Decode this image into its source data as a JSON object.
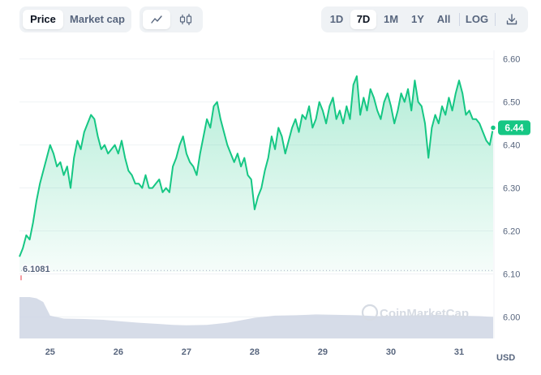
{
  "toolbar": {
    "metric_tabs": [
      "Price",
      "Market cap"
    ],
    "active_metric": "Price",
    "chart_types": [
      "line-chart-icon",
      "candlestick-icon"
    ],
    "active_chart_type": "line-chart-icon",
    "ranges": [
      "1D",
      "7D",
      "1M",
      "1Y",
      "All"
    ],
    "active_range": "7D",
    "scale_label": "LOG",
    "download_icon": "download-icon"
  },
  "watermark": "CoinMarketCap",
  "colors": {
    "line": "#16c784",
    "area_top": "#16c784",
    "volume": "#cfd6e4",
    "badge": "#16c784"
  },
  "chart_data": {
    "type": "area",
    "currency": "USD",
    "current_price_label": "6.44",
    "reference_price_label": "6.1081",
    "reference_price": 6.1081,
    "ylim": [
      5.95,
      6.62
    ],
    "y_ticks": [
      "6.60",
      "6.50",
      "6.40",
      "6.30",
      "6.20",
      "6.10",
      "6.00"
    ],
    "y_tick_values": [
      6.6,
      6.5,
      6.4,
      6.3,
      6.2,
      6.1,
      6.0
    ],
    "x_tick_labels": [
      "25",
      "26",
      "27",
      "28",
      "29",
      "30",
      "31"
    ],
    "xlim": [
      24.55,
      31.5
    ],
    "grid": true,
    "series": [
      {
        "x": [
          24.55,
          24.6,
          24.65,
          24.7,
          24.75,
          24.8,
          24.85,
          24.9,
          24.95,
          25.0,
          25.05,
          25.1,
          25.15,
          25.2,
          25.25,
          25.3,
          25.35,
          25.4,
          25.45,
          25.5,
          25.55,
          25.6,
          25.65,
          25.7,
          25.75,
          25.8,
          25.85,
          25.9,
          25.95,
          26.0,
          26.05,
          26.1,
          26.15,
          26.2,
          26.25,
          26.3,
          26.35,
          26.4,
          26.45,
          26.5,
          26.55,
          26.6,
          26.65,
          26.7,
          26.75,
          26.8,
          26.85,
          26.9,
          26.95,
          27.0,
          27.05,
          27.1,
          27.15,
          27.2,
          27.25,
          27.3,
          27.35,
          27.4,
          27.45,
          27.5,
          27.55,
          27.6,
          27.65,
          27.7,
          27.75,
          27.8,
          27.85,
          27.9,
          27.95,
          28.0,
          28.05,
          28.1,
          28.15,
          28.2,
          28.25,
          28.3,
          28.35,
          28.4,
          28.45,
          28.5,
          28.55,
          28.6,
          28.65,
          28.7,
          28.75,
          28.8,
          28.85,
          28.9,
          28.95,
          29.0,
          29.05,
          29.1,
          29.15,
          29.2,
          29.25,
          29.3,
          29.35,
          29.4,
          29.45,
          29.5,
          29.55,
          29.6,
          29.65,
          29.7,
          29.75,
          29.8,
          29.85,
          29.9,
          29.95,
          30.0,
          30.05,
          30.1,
          30.15,
          30.2,
          30.25,
          30.3,
          30.35,
          30.4,
          30.45,
          30.5,
          30.55,
          30.6,
          30.65,
          30.7,
          30.75,
          30.8,
          30.85,
          30.9,
          30.95,
          31.0,
          31.05,
          31.1,
          31.15,
          31.2,
          31.25,
          31.3,
          31.35,
          31.4,
          31.45,
          31.5
        ],
        "y": [
          6.14,
          6.16,
          6.19,
          6.18,
          6.22,
          6.27,
          6.31,
          6.34,
          6.37,
          6.4,
          6.38,
          6.35,
          6.36,
          6.33,
          6.35,
          6.3,
          6.37,
          6.41,
          6.39,
          6.43,
          6.45,
          6.47,
          6.46,
          6.42,
          6.39,
          6.4,
          6.38,
          6.39,
          6.4,
          6.38,
          6.41,
          6.37,
          6.34,
          6.33,
          6.31,
          6.31,
          6.3,
          6.33,
          6.3,
          6.3,
          6.31,
          6.32,
          6.29,
          6.3,
          6.29,
          6.35,
          6.37,
          6.4,
          6.42,
          6.38,
          6.36,
          6.35,
          6.33,
          6.38,
          6.42,
          6.46,
          6.44,
          6.49,
          6.5,
          6.46,
          6.43,
          6.4,
          6.38,
          6.36,
          6.38,
          6.35,
          6.37,
          6.33,
          6.32,
          6.25,
          6.28,
          6.3,
          6.34,
          6.37,
          6.42,
          6.39,
          6.44,
          6.42,
          6.38,
          6.41,
          6.44,
          6.46,
          6.43,
          6.47,
          6.46,
          6.49,
          6.44,
          6.46,
          6.5,
          6.48,
          6.45,
          6.49,
          6.51,
          6.46,
          6.48,
          6.45,
          6.49,
          6.46,
          6.54,
          6.56,
          6.47,
          6.51,
          6.48,
          6.53,
          6.51,
          6.48,
          6.46,
          6.5,
          6.52,
          6.49,
          6.45,
          6.48,
          6.52,
          6.5,
          6.53,
          6.48,
          6.55,
          6.5,
          6.49,
          6.45,
          6.37,
          6.44,
          6.47,
          6.45,
          6.49,
          6.47,
          6.51,
          6.48,
          6.52,
          6.55,
          6.52,
          6.47,
          6.48,
          6.46,
          6.46,
          6.45,
          6.43,
          6.41,
          6.4,
          6.44
        ]
      }
    ],
    "volume": {
      "x": [
        24.55,
        24.7,
        24.8,
        24.9,
        25.0,
        25.2,
        25.5,
        25.8,
        26.0,
        26.3,
        26.6,
        26.8,
        27.0,
        27.3,
        27.6,
        27.8,
        28.0,
        28.3,
        28.6,
        28.9,
        29.2,
        29.5,
        29.8,
        30.1,
        30.4,
        30.7,
        31.0,
        31.3,
        31.5
      ],
      "y": [
        1.0,
        1.0,
        0.97,
        0.88,
        0.55,
        0.48,
        0.47,
        0.45,
        0.42,
        0.38,
        0.35,
        0.33,
        0.32,
        0.33,
        0.38,
        0.44,
        0.5,
        0.55,
        0.56,
        0.58,
        0.57,
        0.56,
        0.54,
        0.55,
        0.56,
        0.57,
        0.55,
        0.54,
        0.52
      ]
    }
  }
}
